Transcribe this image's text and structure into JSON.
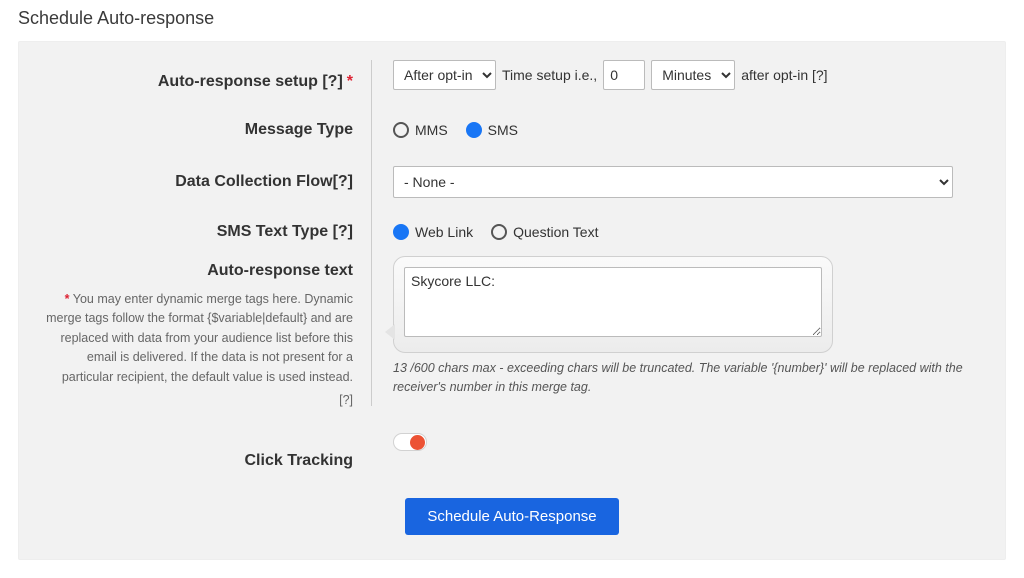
{
  "page_title": "Schedule Auto-response",
  "labels": {
    "auto_response_setup": "Auto-response setup [?]",
    "message_type": "Message Type",
    "data_collection_flow": "Data Collection Flow[?]",
    "sms_text_type": "SMS Text Type [?]",
    "auto_response_text": "Auto-response text",
    "click_tracking": "Click Tracking"
  },
  "setup": {
    "when_options": [
      "After opt-in"
    ],
    "when_selected": "After opt-in",
    "time_setup_label": "Time setup i.e.,",
    "time_value": "0",
    "unit_options": [
      "Minutes"
    ],
    "unit_selected": "Minutes",
    "after_text": "after opt-in [?]"
  },
  "message_type": {
    "options": [
      "MMS",
      "SMS"
    ],
    "selected": "SMS"
  },
  "data_collection_flow": {
    "options": [
      "- None -"
    ],
    "selected": "- None -"
  },
  "sms_text_type": {
    "options": [
      "Web Link",
      "Question Text"
    ],
    "selected": "Web Link"
  },
  "auto_response_text_hint": "You may enter dynamic merge tags here. Dynamic merge tags follow the format {$variable|default} and are replaced with data from your audience list before this email is delivered. If the data is not present for a particular recipient, the default value is used instead.",
  "auto_response_text_hint_suffix": "[?]",
  "textarea_value": "Skycore LLC:",
  "counter_text": "13 /600 chars max - exceeding chars will be truncated. The variable '{number}' will be replaced with the receiver's number in this merge tag.",
  "click_tracking_on": false,
  "submit_label": "Schedule Auto-Response",
  "required_marker": "*"
}
